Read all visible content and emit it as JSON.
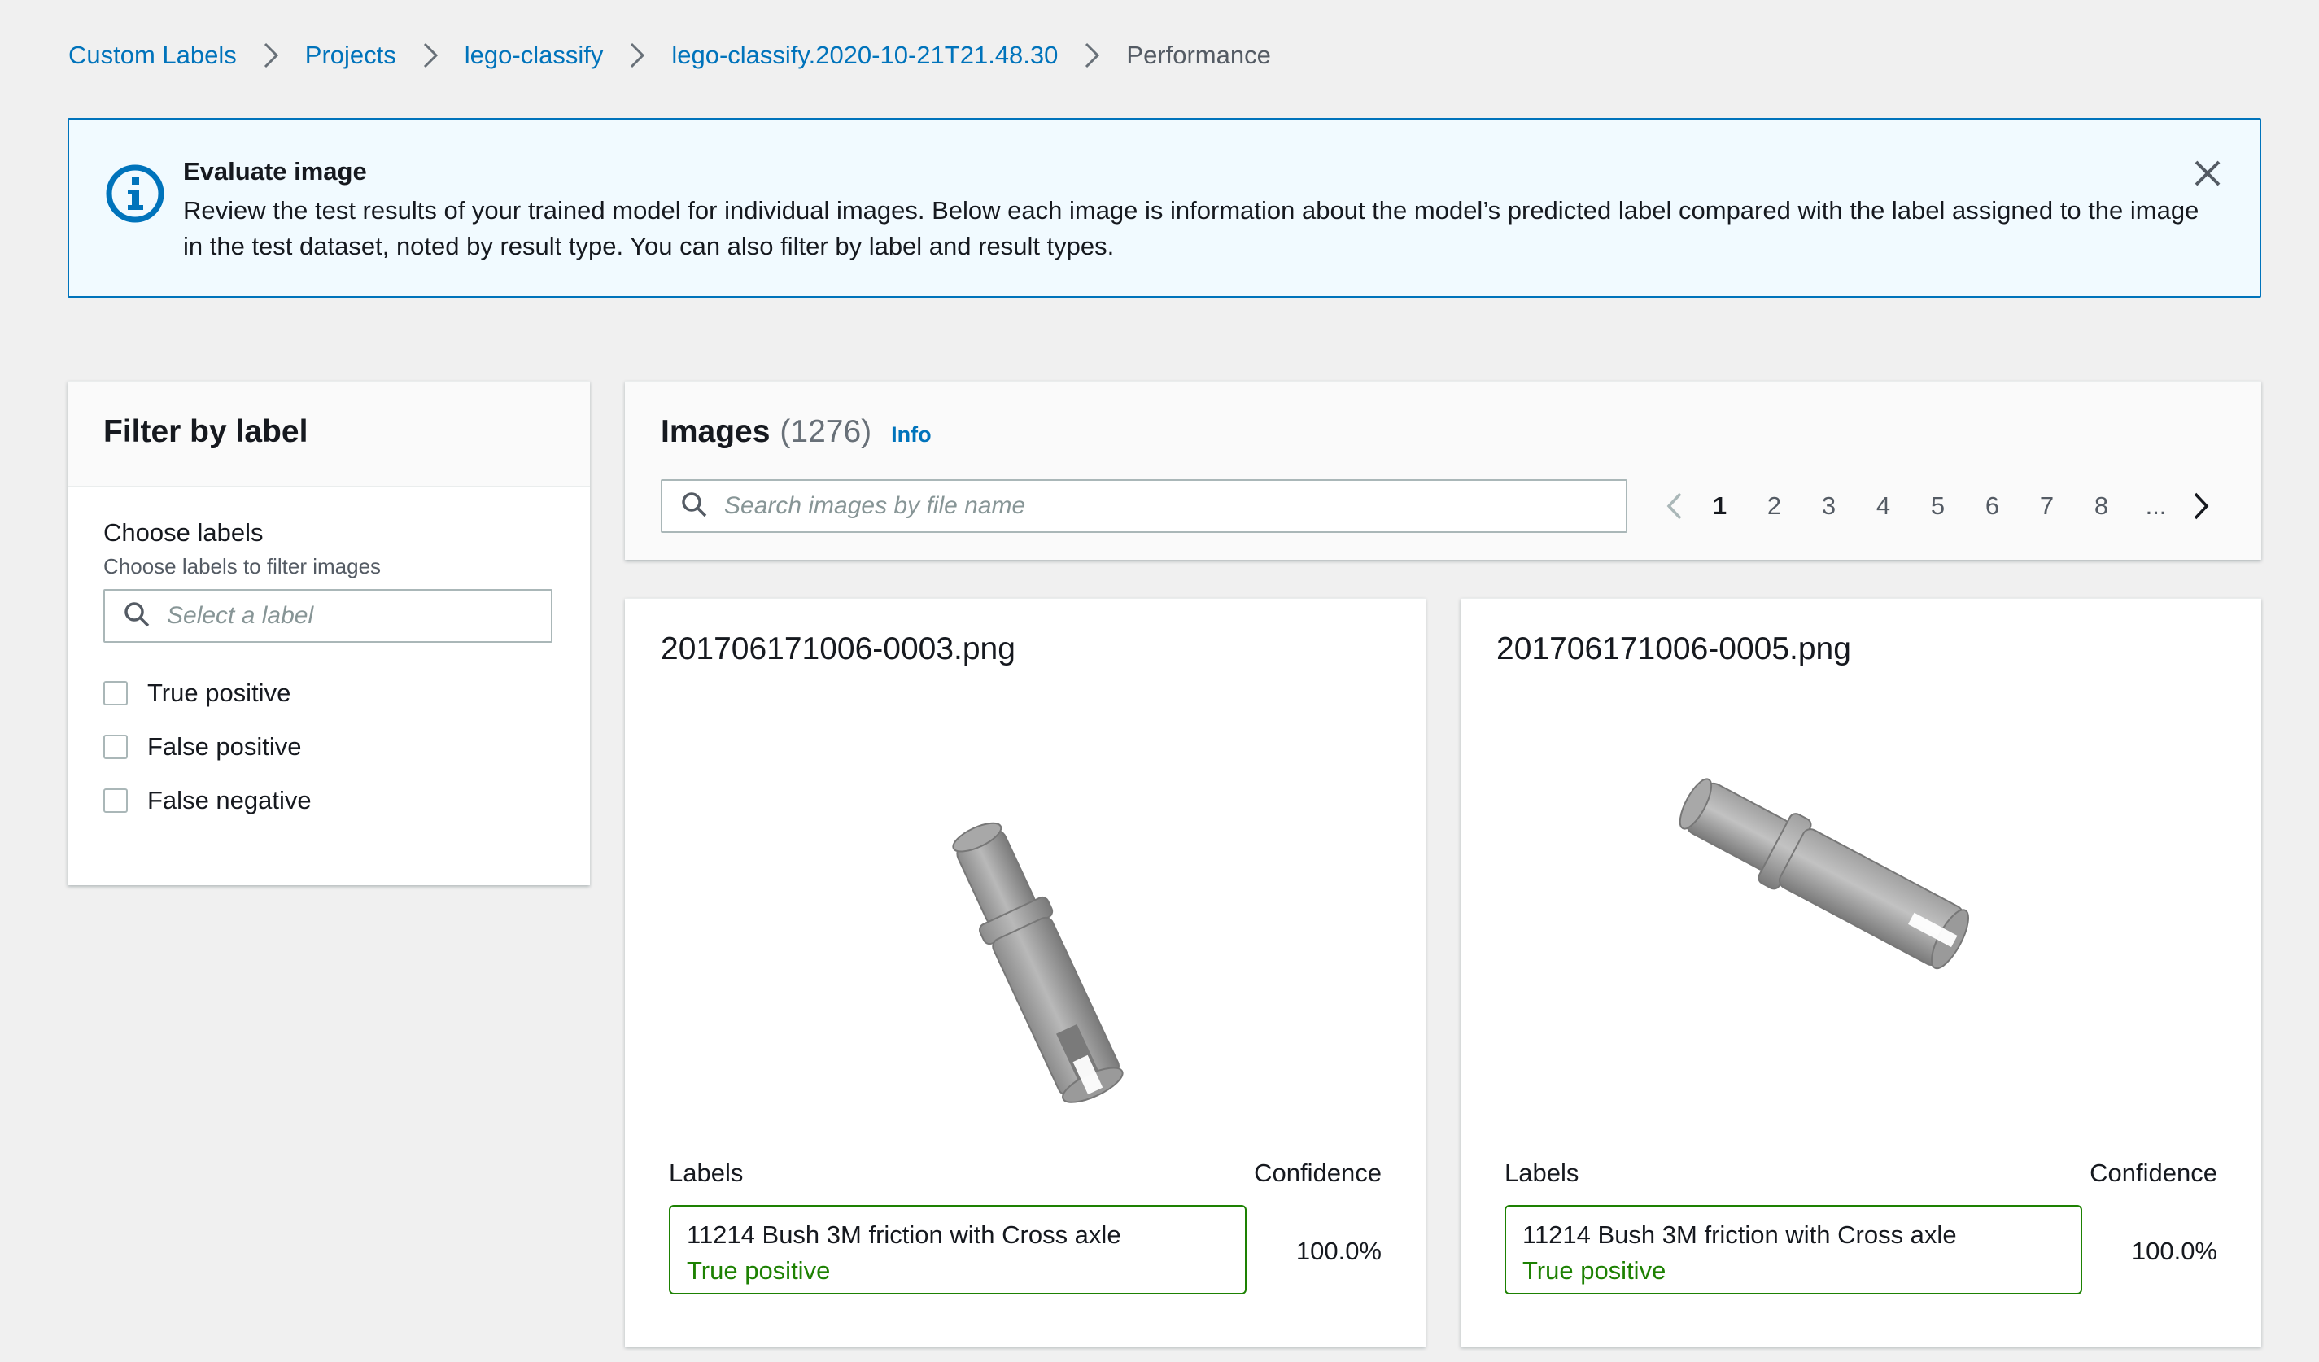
{
  "breadcrumb": {
    "items": [
      "Custom Labels",
      "Projects",
      "lego-classify",
      "lego-classify.2020-10-21T21.48.30"
    ],
    "current": "Performance"
  },
  "flash": {
    "icon": "info-icon",
    "title": "Evaluate image",
    "body": "Review the test results of your trained model for individual images. Below each image is information about the model’s predicted label compared with the label assigned to the image in the test dataset, noted by result type. You can also filter by label and result types.",
    "accent_color": "#0073bb",
    "background_color": "#f1faff"
  },
  "filter": {
    "title": "Filter by label",
    "choose_label": "Choose labels",
    "choose_description": "Choose labels to filter images",
    "select_placeholder": "Select a label",
    "result_types": [
      "True positive",
      "False positive",
      "False negative"
    ]
  },
  "images": {
    "title": "Images",
    "count": "(1276)",
    "info_link": "Info",
    "search_placeholder": "Search images by file name",
    "pagination": {
      "pages": [
        "1",
        "2",
        "3",
        "4",
        "5",
        "6",
        "7",
        "8"
      ],
      "current": "1",
      "ellipsis": "..."
    },
    "column_labels": "Labels",
    "column_confidence": "Confidence",
    "cards": [
      {
        "filename": "201706171006-0003.png",
        "label": "11214 Bush 3M friction with Cross axle",
        "result": "True positive",
        "confidence": "100.0%"
      },
      {
        "filename": "201706171006-0005.png",
        "label": "11214 Bush 3M friction with Cross axle",
        "result": "True positive",
        "confidence": "100.0%"
      }
    ]
  },
  "colors": {
    "link": "#0073bb",
    "success": "#1d8102",
    "text": "#16191f",
    "muted": "#545b64"
  }
}
